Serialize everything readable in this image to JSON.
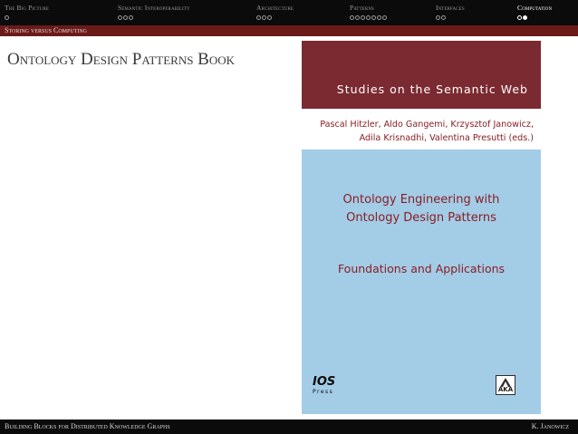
{
  "nav": {
    "sections": [
      {
        "label": "The Big Picture",
        "dots": 1,
        "filled": -1,
        "active": false
      },
      {
        "label": "Semantic Interoperability",
        "dots": 3,
        "filled": -1,
        "active": false
      },
      {
        "label": "Architecture",
        "dots": 3,
        "filled": -1,
        "active": false
      },
      {
        "label": "Patterns",
        "dots": 7,
        "filled": -1,
        "active": false
      },
      {
        "label": "Interfaces",
        "dots": 2,
        "filled": -1,
        "active": false
      },
      {
        "label": "Computation",
        "dots": 2,
        "filled": 1,
        "active": true
      }
    ]
  },
  "subsection": "Storing versus Computing",
  "frame_title": "Ontology Design Patterns Book",
  "cover": {
    "series": "Studies on the Semantic Web",
    "authors_line1": "Pascal Hitzler, Aldo Gangemi, Krzysztof Janowicz,",
    "authors_line2": "Adila Krisnadhi, Valentina Presutti (eds.)",
    "title_line1": "Ontology Engineering with",
    "title_line2": "Ontology Design Patterns",
    "subtitle": "Foundations and Applications",
    "publisher_big": "IOS",
    "publisher_small": "Press",
    "aka": "AKA"
  },
  "footer": {
    "left": "Building Blocks for Distributed Knowledge Graphs",
    "right": "K. Janowicz"
  },
  "colors": {
    "cover_red": "#7b2a31",
    "cover_blue": "#a3cce6",
    "title_red": "#8a1e24",
    "subbar": "#6b1a1a"
  }
}
